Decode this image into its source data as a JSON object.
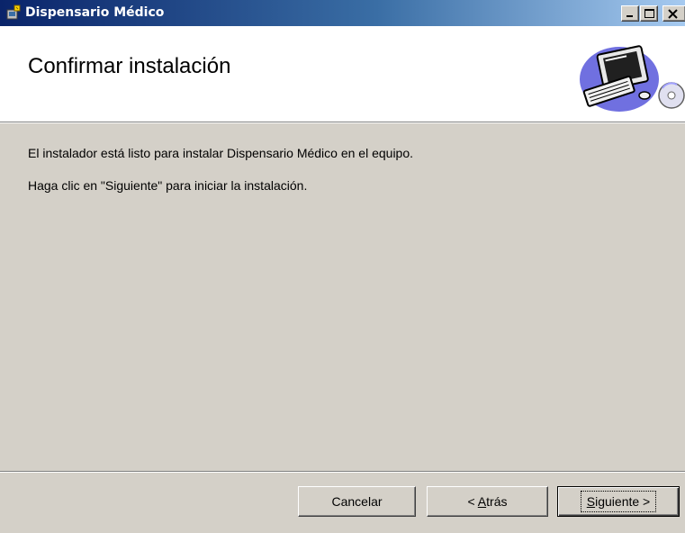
{
  "window": {
    "title": "Dispensario Médico",
    "icon": "installer-icon",
    "controls": [
      "minimize-icon",
      "maximize-icon",
      "close-icon"
    ]
  },
  "header": {
    "title": "Confirmar instalación",
    "graphic": "computer-cd-icon"
  },
  "body": {
    "line1": "El instalador está listo para instalar Dispensario Médico en el equipo.",
    "line2": "Haga clic en \"Siguiente\" para iniciar la instalación."
  },
  "buttons": {
    "cancel": "Cancelar",
    "back_prefix": "< ",
    "back_mnemonic": "A",
    "back_rest": "trás",
    "next_mnemonic": "S",
    "next_rest": "iguiente >"
  },
  "colors": {
    "titlebar_start": "#0a246a",
    "titlebar_end": "#a6caf0",
    "face": "#d4d0c8"
  }
}
